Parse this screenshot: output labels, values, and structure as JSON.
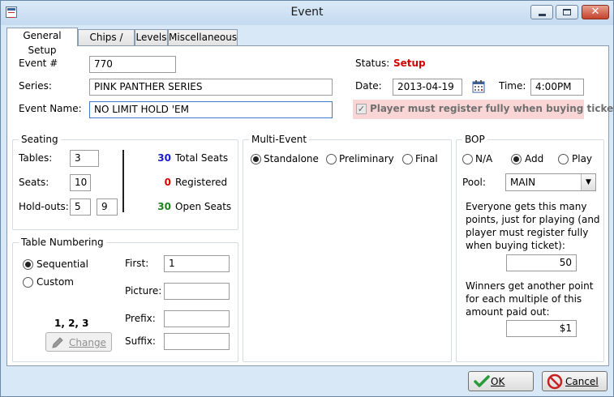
{
  "window": {
    "title": "Event"
  },
  "tabs": [
    "General Setup",
    "Chips / Fees",
    "Levels",
    "Miscellaneous"
  ],
  "event": {
    "number_label": "Event #",
    "number": "770",
    "series_label": "Series:",
    "series": "PINK PANTHER SERIES",
    "name_label": "Event Name:",
    "name": "NO LIMIT HOLD 'EM"
  },
  "status": {
    "status_label": "Status:",
    "status_value": "Setup",
    "status_color": "#d40000",
    "date_label": "Date:",
    "date": "2013-04-19",
    "time_label": "Time:",
    "time": "4:00PM",
    "register_label": "Player must register fully when buying ticket"
  },
  "seating": {
    "title": "Seating",
    "tables_label": "Tables:",
    "tables": "3",
    "seats_label": "Seats:",
    "seats": "10",
    "holdouts_label": "Hold-outs:",
    "holdout1": "5",
    "holdout2": "9",
    "total_seats": "30",
    "total_label": "Total Seats",
    "registered": "0",
    "registered_label": "Registered",
    "open_seats": "30",
    "open_label": "Open Seats",
    "colors": {
      "total": "#1a1ad0",
      "registered": "#d40000",
      "open": "#208020"
    }
  },
  "table_numbering": {
    "title": "Table Numbering",
    "sequential": "Sequential",
    "custom": "Custom",
    "first_label": "First:",
    "first": "1",
    "picture_label": "Picture:",
    "picture": "",
    "prefix_label": "Prefix:",
    "prefix": "",
    "suffix_label": "Suffix:",
    "suffix": "",
    "preview": "1, 2, 3",
    "change_label": "Change"
  },
  "multi_event": {
    "title": "Multi-Event",
    "standalone": "Standalone",
    "preliminary": "Preliminary",
    "final": "Final"
  },
  "bop": {
    "title": "BOP",
    "na": "N/A",
    "add": "Add",
    "play": "Play",
    "pool_label": "Pool:",
    "pool": "MAIN",
    "points_text": "Everyone gets this many points, just for playing (and player must register fully when buying ticket):",
    "points": "50",
    "winners_text": "Winners get another point for each multiple of this amount paid out:",
    "amount": "$1"
  },
  "buttons": {
    "ok": "OK",
    "cancel": "Cancel"
  }
}
